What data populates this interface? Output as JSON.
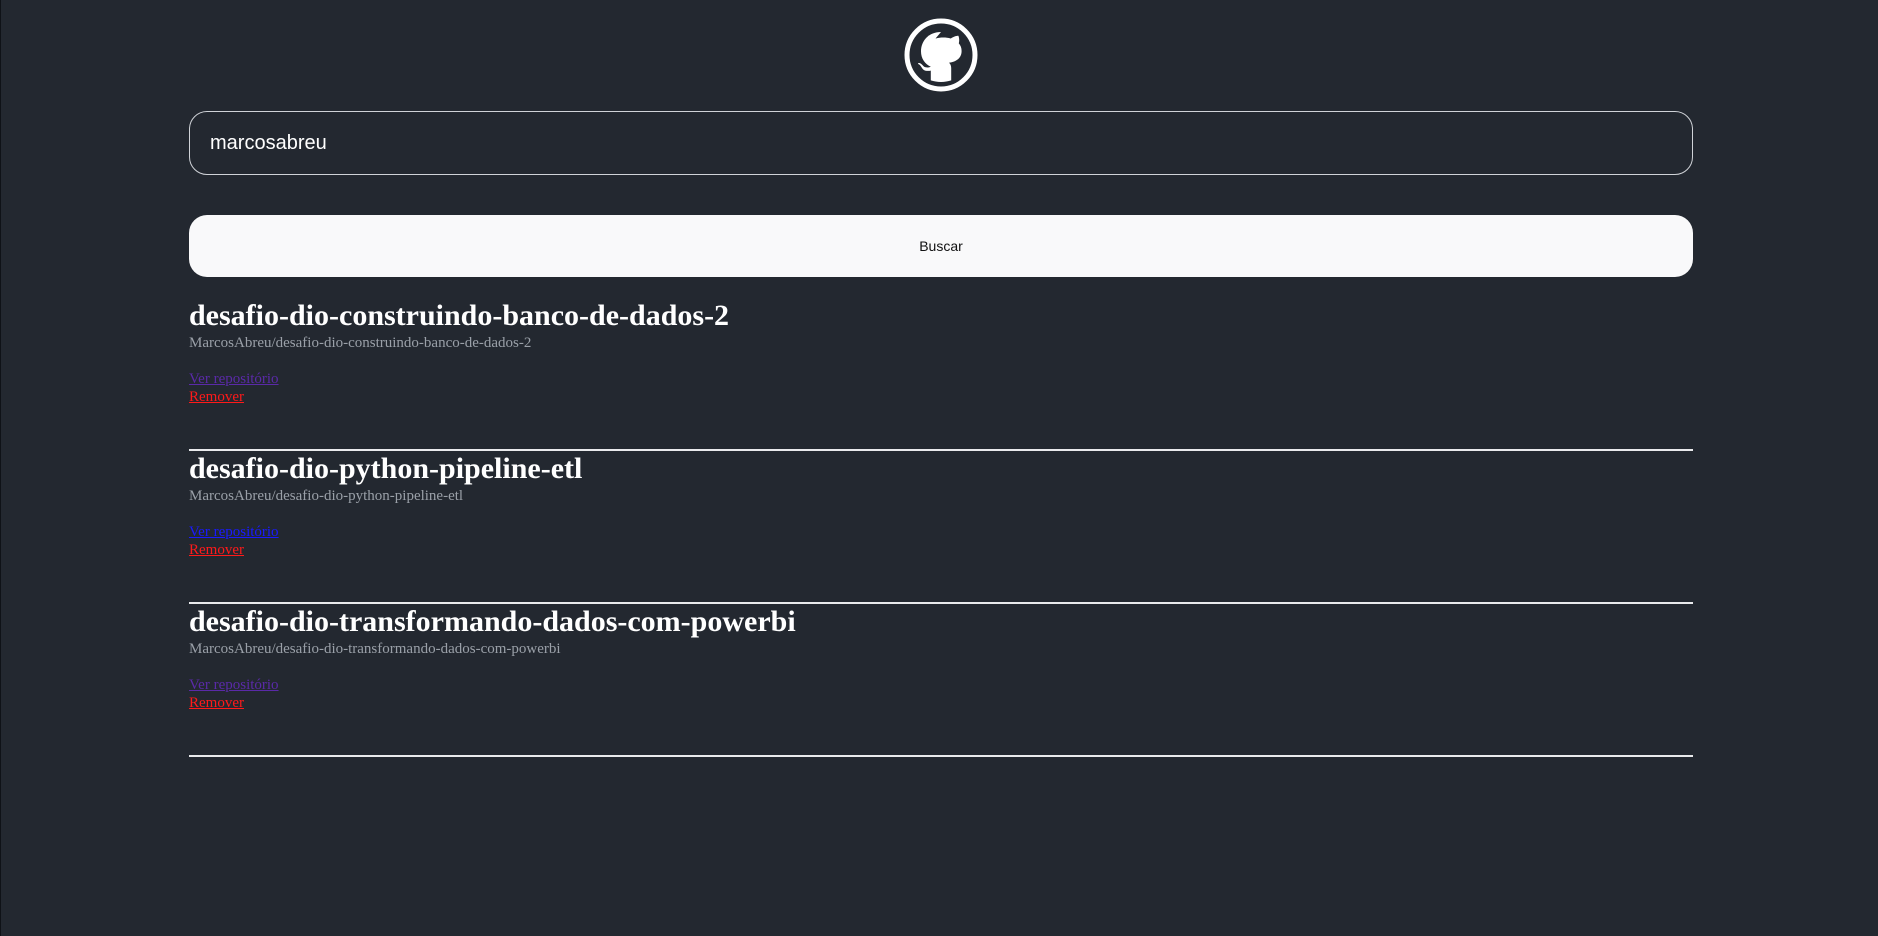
{
  "logo": {
    "icon": "github-icon",
    "color": "#ffffff"
  },
  "search": {
    "value": "marcosabreu",
    "placeholder": ""
  },
  "button": {
    "label": "Buscar"
  },
  "repos": [
    {
      "name": "desafio-dio-construindo-banco-de-dados-2",
      "full_name": "MarcosAbreu/desafio-dio-construindo-banco-de-dados-2",
      "view_label": "Ver repositório",
      "remove_label": "Remover",
      "view_state": "visited"
    },
    {
      "name": "desafio-dio-python-pipeline-etl",
      "full_name": "MarcosAbreu/desafio-dio-python-pipeline-etl",
      "view_label": "Ver repositório",
      "remove_label": "Remover",
      "view_state": "unvisited"
    },
    {
      "name": "desafio-dio-transformando-dados-com-powerbi",
      "full_name": "MarcosAbreu/desafio-dio-transformando-dados-com-powerbi",
      "view_label": "Ver repositório",
      "remove_label": "Remover",
      "view_state": "visited"
    }
  ],
  "colors": {
    "background": "#232830",
    "link_visited": "#5a2aa8",
    "link_unvisited": "#1a1aff",
    "remove": "#ff1a1a"
  }
}
